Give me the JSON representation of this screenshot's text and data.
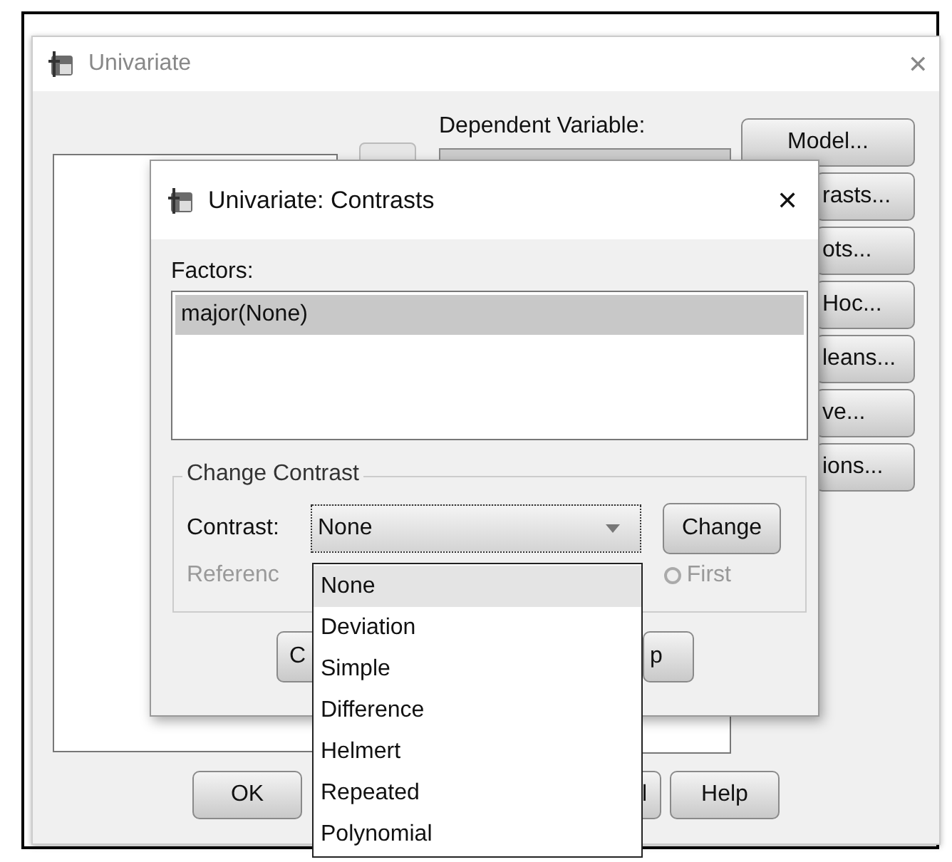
{
  "main_window": {
    "title": "Univariate",
    "close": "✕",
    "dependent_variable": {
      "label": "Dependent Variable:"
    },
    "side_buttons": [
      {
        "label": "Model...",
        "clipped": false
      },
      {
        "label": "rasts...",
        "clipped": true
      },
      {
        "label": "ots...",
        "clipped": true
      },
      {
        "label": "Hoc...",
        "clipped": true
      },
      {
        "label": "leans...",
        "clipped": true
      },
      {
        "label": "ve...",
        "clipped": true
      },
      {
        "label": "ions...",
        "clipped": true
      }
    ],
    "bottom_buttons": [
      {
        "label": "OK"
      },
      {
        "label": "l"
      },
      {
        "label": "Help"
      }
    ]
  },
  "dialog": {
    "title": "Univariate: Contrasts",
    "close": "✕",
    "factors_label": {
      "label": "Factors:"
    },
    "factors": [
      {
        "label": "major(None)",
        "selected": true
      }
    ],
    "group": {
      "title": "Change Contrast",
      "contrast_label": {
        "label": "Contrast:"
      },
      "contrast_value": "None",
      "change_button": {
        "label": "Change"
      },
      "reference_label": "Referenc",
      "first_radio": {
        "label": "First",
        "checked": false,
        "disabled": true
      }
    },
    "buttons": [
      {
        "label": "C"
      },
      {
        "label": "p"
      }
    ]
  },
  "dropdown": {
    "options": [
      {
        "label": "None",
        "selected": true
      },
      {
        "label": "Deviation",
        "selected": false
      },
      {
        "label": "Simple",
        "selected": false
      },
      {
        "label": "Difference",
        "selected": false
      },
      {
        "label": "Helmert",
        "selected": false
      },
      {
        "label": "Repeated",
        "selected": false
      },
      {
        "label": "Polynomial",
        "selected": false
      }
    ]
  }
}
